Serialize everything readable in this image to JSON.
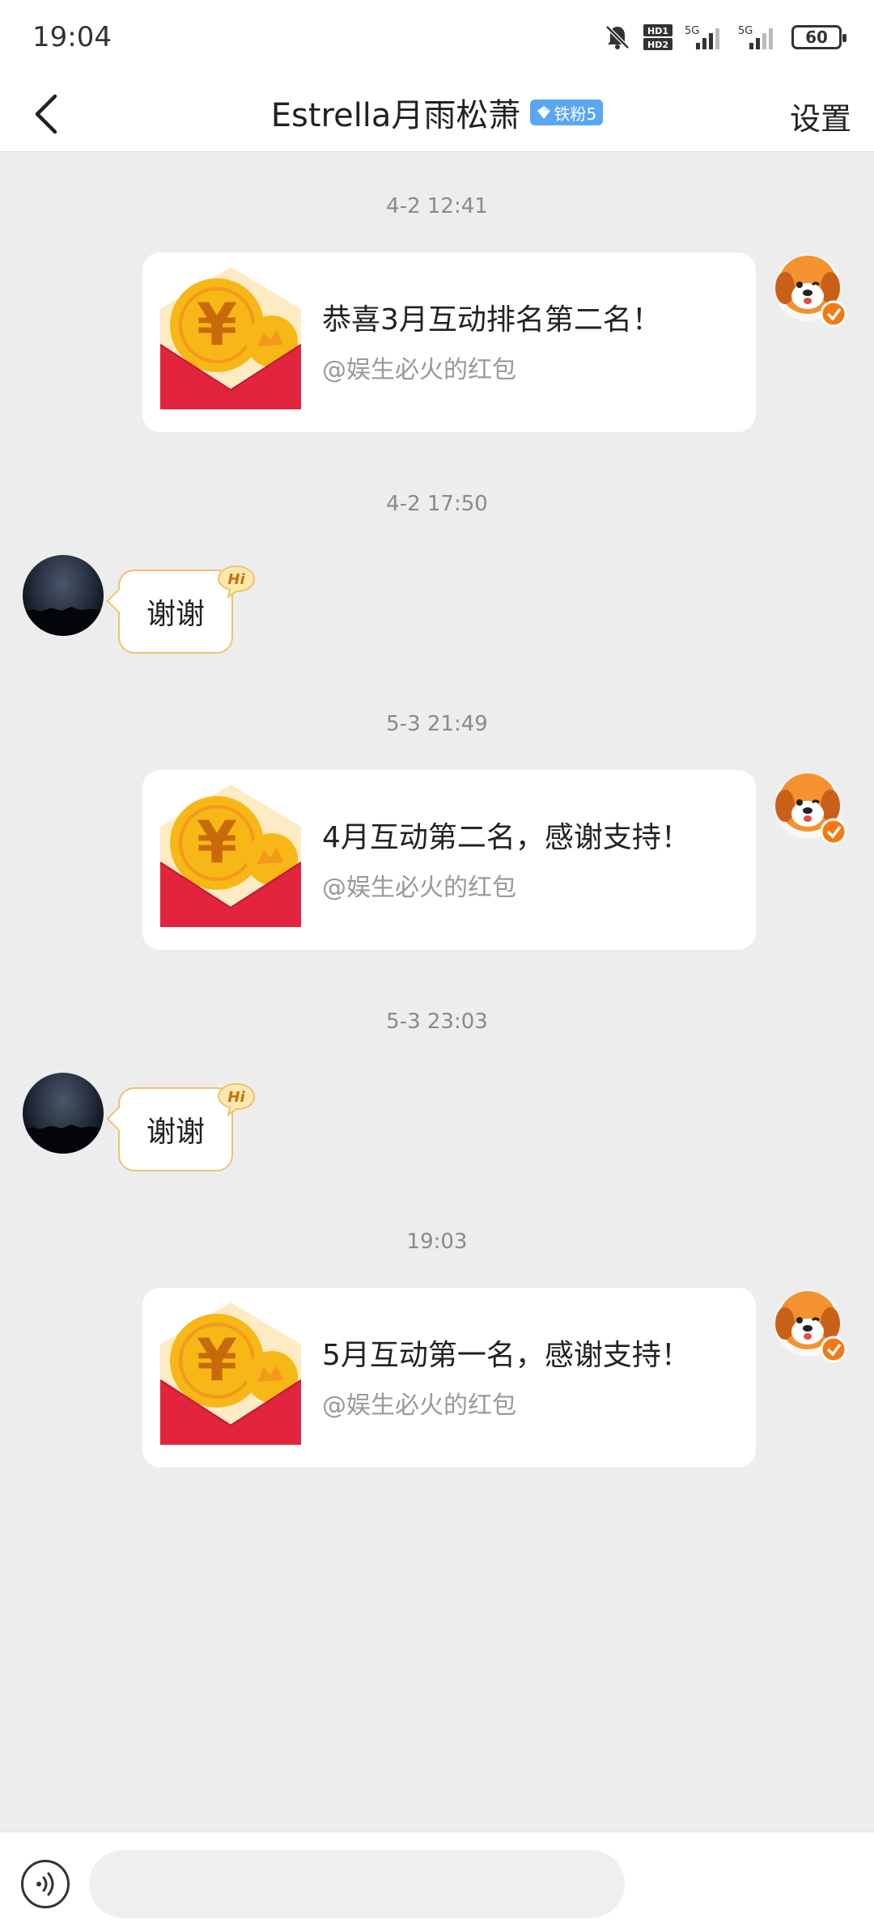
{
  "status_bar": {
    "time": "19:04",
    "network_1": "5G",
    "network_2": "5G",
    "hd_label_1": "HD1",
    "hd_label_2": "HD2",
    "battery": "60"
  },
  "header": {
    "title": "Estrella月雨松萧",
    "fan_badge": "铁粉5",
    "settings_label": "设置"
  },
  "messages": [
    {
      "time": "4-2 12:41",
      "title": "恭喜3月互动排名第二名！",
      "subtitle": "@娱生必火的红包"
    },
    {
      "time": "4-2 17:50",
      "text": "谢谢"
    },
    {
      "time": "5-3 21:49",
      "title": "4月互动第二名，感谢支持！",
      "subtitle": "@娱生必火的红包"
    },
    {
      "time": "5-3 23:03",
      "text": "谢谢"
    },
    {
      "time": "19:03",
      "title": "5月互动第一名，感谢支持！",
      "subtitle": "@娱生必火的红包"
    }
  ],
  "badges": {
    "hi": "Hi"
  },
  "composer": {
    "placeholder": ""
  },
  "colors": {
    "envelope_red": "#e3243f",
    "coin_gold": "#f7b716",
    "dog_orange": "#f4922f",
    "bubble_border": "#f0c36a"
  }
}
